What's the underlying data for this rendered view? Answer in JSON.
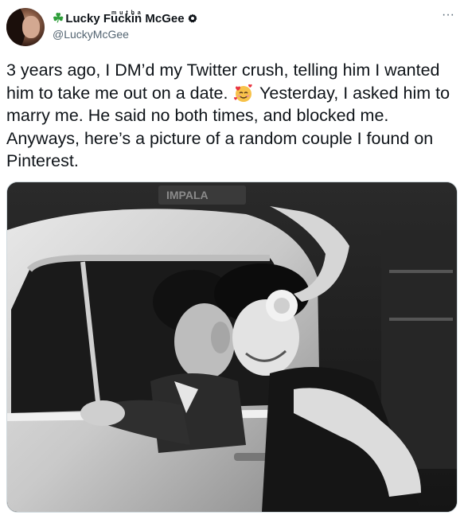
{
  "user": {
    "display_name_prefix": "Lucky ",
    "display_name_mid": "Fuckin",
    "display_name_suffix": " McGee",
    "tiny_label": "m u t h a",
    "handle": "@LuckyMcGee",
    "shamrock": "☘",
    "verified_icon": "verified-badge-icon"
  },
  "more_label": "···",
  "tweet": {
    "text_part1": "3 years ago, I DM’d my Twitter crush, telling him I wanted him to take me out on a date. ",
    "text_part2": " Yesterday, I asked him to marry me. He said no both times, and blocked me. Anyways, here’s a picture of a random couple I found on Pinterest."
  },
  "photo": {
    "car_sign": "IMPALA",
    "alt": "black and white photo of a couple kissing at a car window"
  },
  "colors": {
    "text": "#0f1419",
    "secondary": "#536471",
    "shamrock": "#2e9e3a",
    "border": "#cfd9de"
  }
}
